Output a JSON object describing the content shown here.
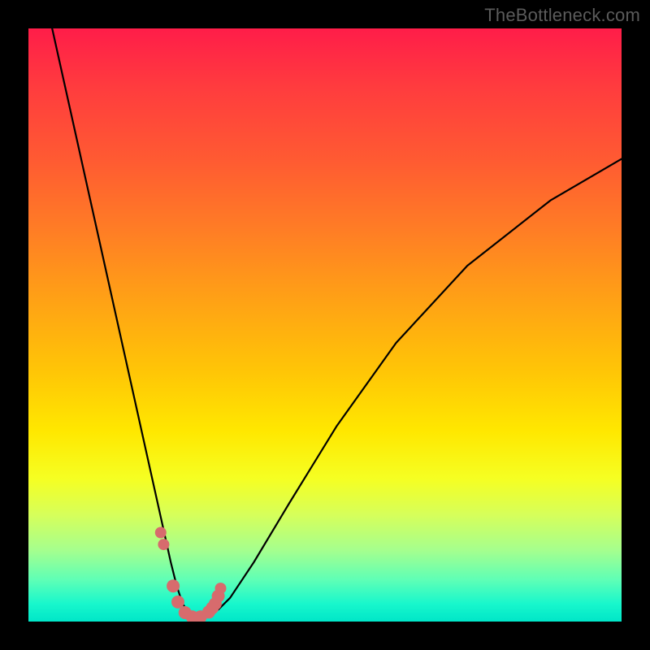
{
  "watermark": "TheBottleneck.com",
  "chart_data": {
    "type": "line",
    "title": "",
    "xlabel": "",
    "ylabel": "",
    "xlim": [
      0,
      100
    ],
    "ylim": [
      0,
      100
    ],
    "series": [
      {
        "name": "bottleneck-curve",
        "x": [
          4,
          6,
          8,
          10,
          12,
          14,
          16,
          18,
          20,
          22,
          24,
          25,
          26,
          27,
          28,
          29,
          30,
          32,
          34,
          38,
          44,
          52,
          62,
          74,
          88,
          100
        ],
        "y": [
          100,
          91,
          82,
          73,
          64,
          55,
          46,
          37,
          28,
          19,
          10,
          6,
          3,
          1.5,
          1,
          1,
          1.2,
          2,
          4,
          10,
          20,
          33,
          47,
          60,
          71,
          78
        ]
      }
    ],
    "markers": {
      "name": "highlight-dots",
      "x": [
        22.3,
        22.8,
        24.4,
        25.2,
        26.4,
        27.6,
        29.0,
        30.4,
        31.0,
        31.5,
        32.0,
        32.4
      ],
      "y": [
        15.0,
        13.0,
        6.0,
        3.3,
        1.5,
        0.8,
        0.8,
        1.6,
        2.3,
        3.0,
        4.3,
        5.6
      ],
      "radius": [
        7,
        7,
        8,
        8,
        8,
        8,
        8,
        8,
        8,
        8,
        8,
        7
      ]
    },
    "gradient_stops": [
      {
        "pos": 0,
        "color": "#ff1d49"
      },
      {
        "pos": 10,
        "color": "#ff3c3e"
      },
      {
        "pos": 22,
        "color": "#ff5a32"
      },
      {
        "pos": 34,
        "color": "#ff7d25"
      },
      {
        "pos": 46,
        "color": "#ffa215"
      },
      {
        "pos": 58,
        "color": "#ffc606"
      },
      {
        "pos": 68,
        "color": "#ffe800"
      },
      {
        "pos": 76,
        "color": "#f5ff23"
      },
      {
        "pos": 82,
        "color": "#d6ff5a"
      },
      {
        "pos": 88,
        "color": "#a5ff8e"
      },
      {
        "pos": 93,
        "color": "#5effb6"
      },
      {
        "pos": 97,
        "color": "#18f7cc"
      },
      {
        "pos": 100,
        "color": "#00e6c8"
      }
    ]
  }
}
